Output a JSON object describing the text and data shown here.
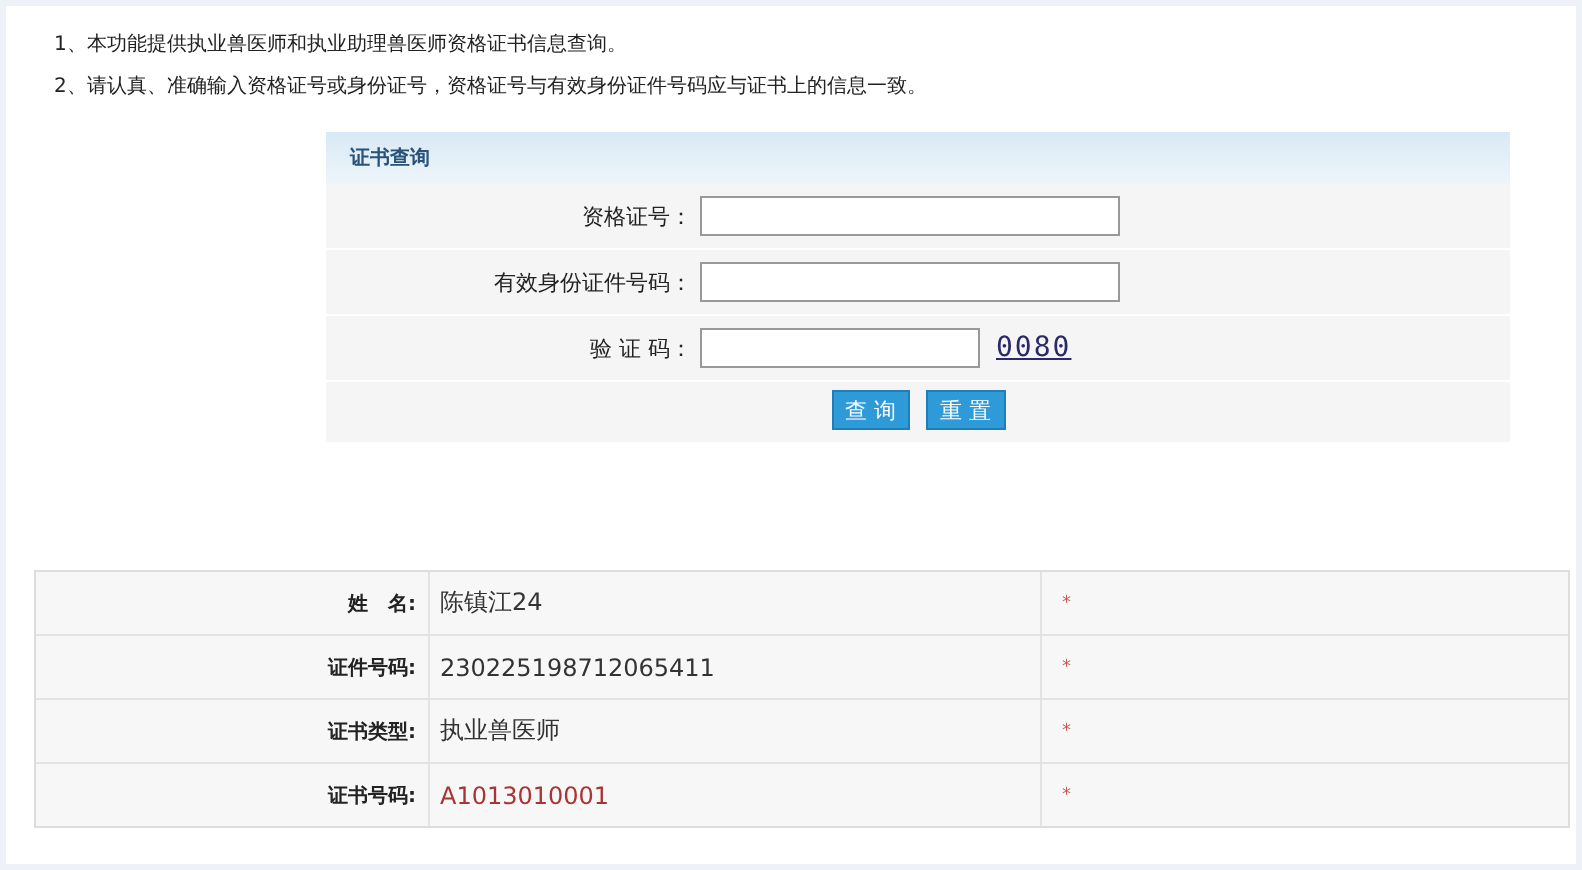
{
  "notes": [
    "1、本功能提供执业兽医师和执业助理兽医师资格证书信息查询。",
    "2、请认真、准确输入资格证号或身份证号，资格证号与有效身份证件号码应与证书上的信息一致。"
  ],
  "query_form": {
    "title": "证书查询",
    "fields": [
      {
        "label": "资格证号：",
        "kind": "text"
      },
      {
        "label": "有效身份证件号码：",
        "kind": "text"
      },
      {
        "label": "验 证 码：",
        "kind": "captcha",
        "captcha": "0080"
      }
    ],
    "buttons": [
      "查 询",
      "重 置"
    ]
  },
  "result_table": {
    "rows": [
      {
        "label": "姓　名:",
        "value": "陈镇江24",
        "mark": "*",
        "emphasis": false
      },
      {
        "label": "证件号码:",
        "value": "230225198712065411",
        "mark": "*",
        "emphasis": false
      },
      {
        "label": "证书类型:",
        "value": "执业兽医师",
        "mark": "*",
        "emphasis": false
      },
      {
        "label": "证书号码:",
        "value": "A1013010001",
        "mark": "*",
        "emphasis": true
      }
    ]
  }
}
